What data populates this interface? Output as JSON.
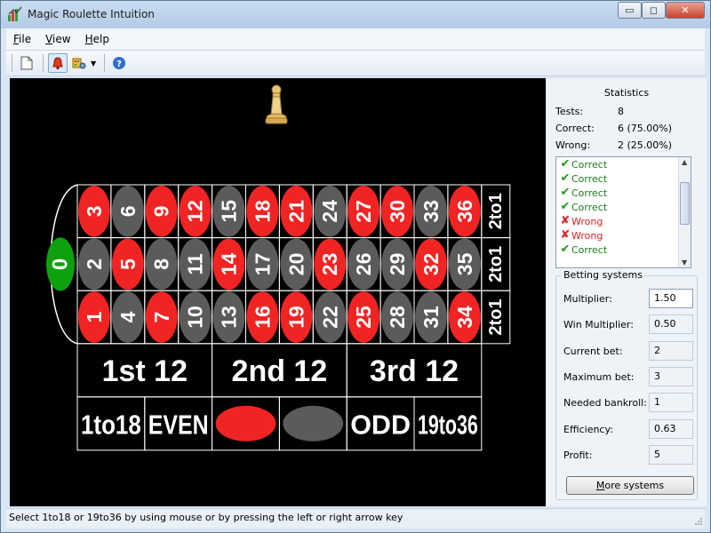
{
  "window": {
    "title": "Magic Roulette Intuition",
    "minimize_glyph": "▭",
    "maximize_glyph": "◻",
    "close_glyph": "✕"
  },
  "menubar": {
    "items": [
      {
        "label": "File",
        "accel": "F",
        "rest": "ile"
      },
      {
        "label": "View",
        "accel": "V",
        "rest": "iew"
      },
      {
        "label": "Help",
        "accel": "H",
        "rest": "elp"
      }
    ]
  },
  "toolbar": {
    "buttons": [
      {
        "icon": "new-document-icon"
      },
      {
        "icon": "bell-icon",
        "active": true
      },
      {
        "icon": "palette-icon"
      },
      {
        "icon": "help-icon"
      }
    ],
    "dropdown_glyph": "▼"
  },
  "roulette": {
    "marker_icon": "chess-pawn-icon",
    "zero": "0",
    "rows": [
      {
        "numbers": [
          "3",
          "6",
          "9",
          "12",
          "15",
          "18",
          "21",
          "24",
          "27",
          "30",
          "33",
          "36"
        ],
        "colors": [
          "red",
          "gray",
          "red",
          "red",
          "gray",
          "red",
          "red",
          "gray",
          "red",
          "red",
          "gray",
          "red"
        ],
        "column_label": "2to1"
      },
      {
        "numbers": [
          "2",
          "5",
          "8",
          "11",
          "14",
          "17",
          "20",
          "23",
          "26",
          "29",
          "32",
          "35"
        ],
        "colors": [
          "gray",
          "red",
          "gray",
          "gray",
          "red",
          "gray",
          "gray",
          "red",
          "gray",
          "gray",
          "red",
          "gray"
        ],
        "column_label": "2to1"
      },
      {
        "numbers": [
          "1",
          "4",
          "7",
          "10",
          "13",
          "16",
          "19",
          "22",
          "25",
          "28",
          "31",
          "34"
        ],
        "colors": [
          "red",
          "gray",
          "red",
          "gray",
          "gray",
          "red",
          "red",
          "gray",
          "red",
          "gray",
          "gray",
          "red"
        ],
        "column_label": "2to1"
      }
    ],
    "dozens": [
      "1st 12",
      "2nd 12",
      "3rd 12"
    ],
    "outside_bets": [
      {
        "label": "1to18",
        "kind": "text"
      },
      {
        "label": "EVEN",
        "kind": "text"
      },
      {
        "label": "",
        "kind": "red"
      },
      {
        "label": "",
        "kind": "gray"
      },
      {
        "label": "ODD",
        "kind": "text"
      },
      {
        "label": "19to36",
        "kind": "text"
      }
    ],
    "colors": {
      "red": "#f12424",
      "gray": "#5b5b5b",
      "green": "#0ea10e",
      "felt": "#000000",
      "line": "#ffffff"
    }
  },
  "statistics": {
    "title": "Statistics",
    "tests_label": "Tests:",
    "tests_value": "8",
    "correct_label": "Correct:",
    "correct_value": "6 (75.00%)",
    "wrong_label": "Wrong:",
    "wrong_value": "2 (25.00%)"
  },
  "results": [
    {
      "text": "Correct",
      "ok": true
    },
    {
      "text": "Correct",
      "ok": true
    },
    {
      "text": "Correct",
      "ok": true
    },
    {
      "text": "Correct",
      "ok": true
    },
    {
      "text": "Wrong",
      "ok": false
    },
    {
      "text": "Wrong",
      "ok": false
    },
    {
      "text": "Correct",
      "ok": true
    }
  ],
  "betting": {
    "title": "Betting systems",
    "rows": [
      {
        "label": "Multiplier:",
        "value": "1.50",
        "editable": true
      },
      {
        "label": "Win Multiplier:",
        "value": "0.50",
        "editable": false
      },
      {
        "label": "Current bet:",
        "value": "2",
        "editable": false
      },
      {
        "label": "Maximum bet:",
        "value": "3",
        "editable": false
      },
      {
        "label": "Needed bankroll:",
        "value": "1",
        "editable": false
      },
      {
        "label": "Efficiency:",
        "value": "0.63",
        "editable": false
      },
      {
        "label": "Profit:",
        "value": "5",
        "editable": false
      }
    ],
    "more_button": {
      "accel": "M",
      "rest": "ore systems"
    }
  },
  "status": {
    "text": "Select 1to18 or 19to36 by using mouse or by pressing the left or right arrow key"
  }
}
